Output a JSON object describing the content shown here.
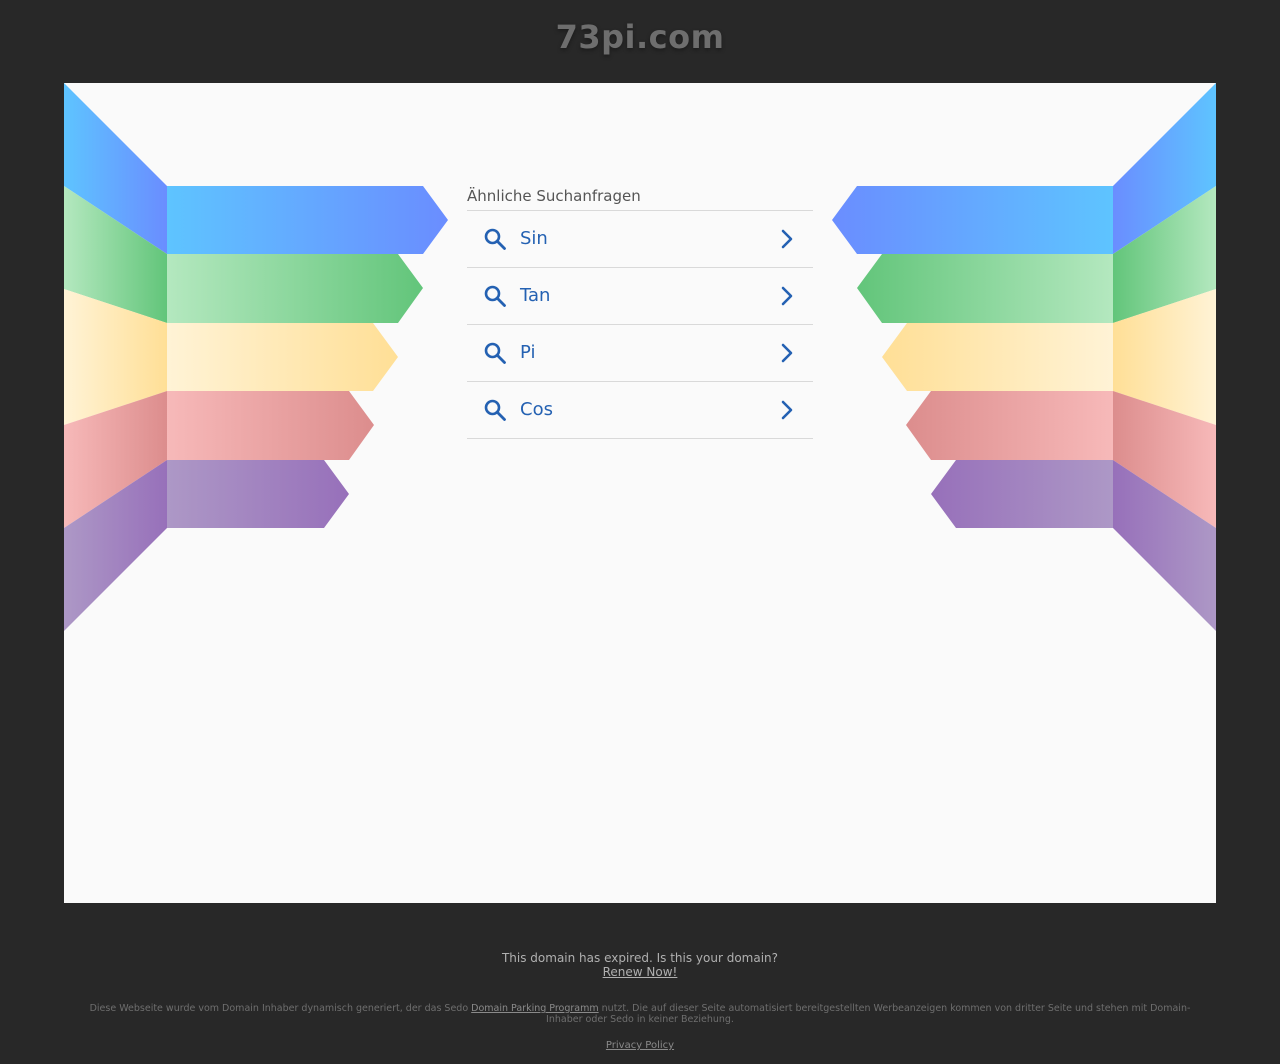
{
  "header": {
    "domain": "73pi.com"
  },
  "related": {
    "heading": "Ähnliche Suchanfragen",
    "items": [
      {
        "label": "Sin"
      },
      {
        "label": "Tan"
      },
      {
        "label": "Pi"
      },
      {
        "label": "Cos"
      }
    ]
  },
  "footer": {
    "expired_text": "This domain has expired. Is this your domain?",
    "renew_label": "Renew Now!",
    "disclaimer_before": "Diese Webseite wurde vom Domain Inhaber dynamisch generiert, der das Sedo ",
    "disclaimer_link": "Domain Parking Programm",
    "disclaimer_after": " nutzt. Die auf dieser Seite automatisiert bereitgestellten Werbeanzeigen kommen von dritter Seite und stehen mit Domain-Inhaber oder Sedo in keiner Beziehung.",
    "privacy_label": "Privacy Policy"
  },
  "colors": {
    "page_background": "#282828",
    "panel_background": "#fafafa",
    "link_blue": "#2461b2",
    "ribbon_blue": "#5aa9ff",
    "ribbon_green": "#6cc781",
    "ribbon_yellow": "#ffe3a0",
    "ribbon_red": "#e39a9a",
    "ribbon_purple": "#9b78be"
  },
  "icons": {
    "search": "search-icon",
    "chevron": "chevron-right-icon"
  }
}
